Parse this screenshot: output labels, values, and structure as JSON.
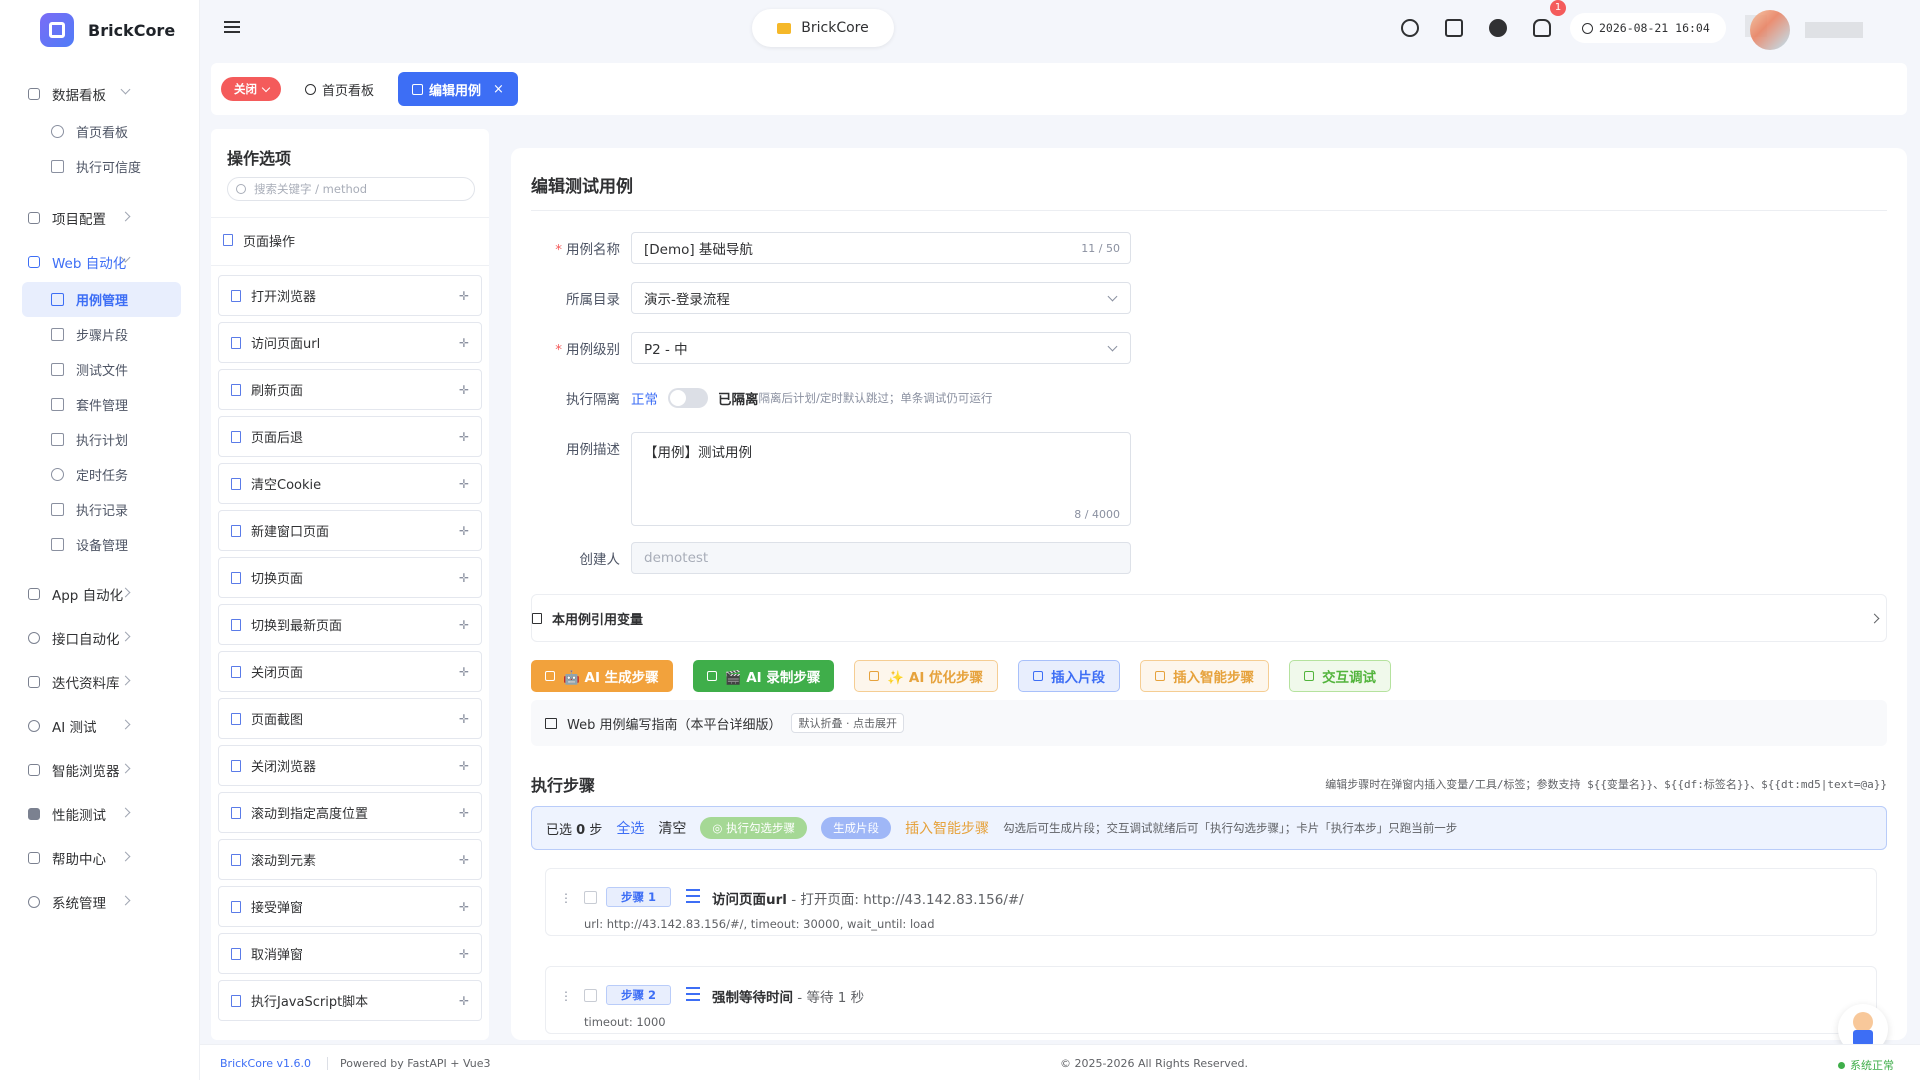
{
  "app": {
    "name": "BrickCore"
  },
  "sidebar": {
    "groups": [
      {
        "label": "数据看板",
        "expanded": true,
        "items": [
          "首页看板",
          "执行可信度"
        ]
      },
      {
        "label": "项目配置"
      },
      {
        "label": "Web 自动化",
        "expanded": true,
        "active": true,
        "items": [
          "用例管理",
          "步骤片段",
          "测试文件",
          "套件管理",
          "执行计划",
          "定时任务",
          "执行记录",
          "设备管理"
        ]
      },
      {
        "label": "App 自动化"
      },
      {
        "label": "接口自动化"
      },
      {
        "label": "迭代资料库"
      },
      {
        "label": "AI 测试"
      },
      {
        "label": "智能浏览器"
      },
      {
        "label": "性能测试"
      },
      {
        "label": "帮助中心"
      },
      {
        "label": "系统管理"
      }
    ]
  },
  "topbar": {
    "project": "BrickCore",
    "notification_count": "1",
    "datetime": "2026-08-21 16:04"
  },
  "tabs": {
    "close_label": "关闭",
    "items": [
      {
        "label": "首页看板",
        "active": false
      },
      {
        "label": "编辑用例",
        "active": true
      }
    ]
  },
  "ops": {
    "title": "操作选项",
    "search_placeholder": "搜索关键字 / method",
    "section": "页面操作",
    "items": [
      "打开浏览器",
      "访问页面url",
      "刷新页面",
      "页面后退",
      "清空Cookie",
      "新建窗口页面",
      "切换页面",
      "切换到最新页面",
      "关闭页面",
      "页面截图",
      "关闭浏览器",
      "滚动到指定高度位置",
      "滚动到元素",
      "接受弹窗",
      "取消弹窗",
      "执行JavaScript脚本"
    ]
  },
  "form": {
    "title": "编辑测试用例",
    "name_label": "用例名称",
    "name_value": "[Demo] 基础导航",
    "name_count": "11 / 50",
    "dir_label": "所属目录",
    "dir_value": "演示-登录流程",
    "level_label": "用例级别",
    "level_value": "P2 - 中",
    "iso_label": "执行隔离",
    "iso_normal": "正常",
    "iso_on": "已隔离",
    "iso_hint": "隔离后计划/定时默认跳过；单条调试仍可运行",
    "desc_label": "用例描述",
    "desc_value": "【用例】测试用例",
    "desc_count": "8 / 4000",
    "creator_label": "创建人",
    "creator_placeholder": "demotest"
  },
  "vars_label": "本用例引用变量",
  "actions": [
    "🤖 AI 生成步骤",
    "🎬 AI 录制步骤",
    "✨ AI 优化步骤",
    "插入片段",
    "插入智能步骤",
    "交互调试"
  ],
  "guide": {
    "label": "Web 用例编写指南（本平台详细版）",
    "tag": "默认折叠 · 点击展开"
  },
  "steps": {
    "title": "执行步骤",
    "hint": "编辑步骤时在弹窗内插入变量/工具/标签；参数支持 ${{变量名}}、${{df:标签名}}、${{dt:md5|text=@a}}",
    "selected_prefix": "已选",
    "selected_count": "0",
    "selected_suffix": "步",
    "select_all": "全选",
    "clear": "清空",
    "run_selected": "执行勾选步骤",
    "gen_fragment": "生成片段",
    "insert_smart": "插入智能步骤",
    "bar_hint": "勾选后可生成片段；交互调试就绪后可「执行勾选步骤」；卡片「执行本步」只跑当前一步",
    "items": [
      {
        "tag": "步骤 1",
        "name": "访问页面url",
        "desc": " - 打开页面: http://43.142.83.156/#/",
        "params": "url: http://43.142.83.156/#/, timeout: 30000, wait_until: load"
      },
      {
        "tag": "步骤 2",
        "name": "强制等待时间",
        "desc": " - 等待 1 秒",
        "params": "timeout: 1000"
      }
    ]
  },
  "footer": {
    "version": "BrickCore v1.6.0",
    "powered": "Powered by FastAPI + Vue3",
    "copyright": "© 2025-2026 All Rights Reserved.",
    "status": "系统正常"
  }
}
